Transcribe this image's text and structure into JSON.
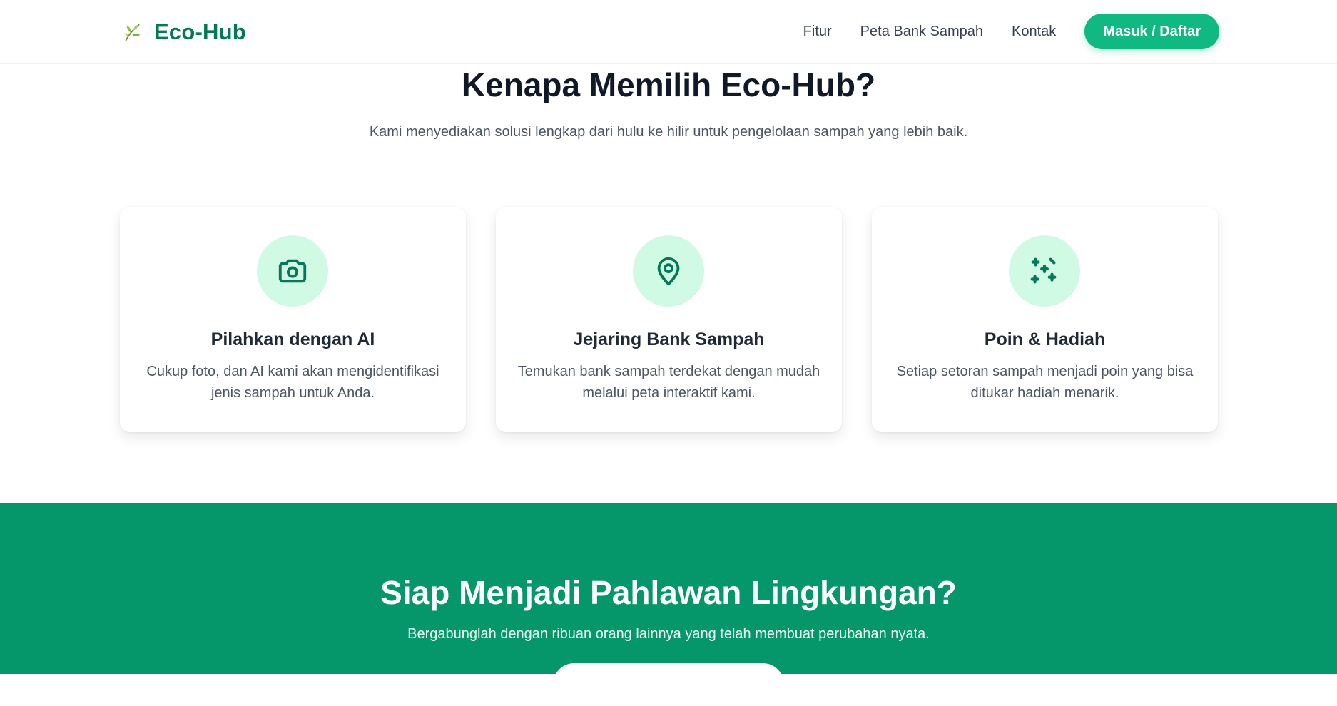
{
  "header": {
    "brand": {
      "name": "Eco-Hub",
      "icon": "leaf-icon",
      "color": "#047857"
    },
    "nav": [
      {
        "label": "Fitur"
      },
      {
        "label": "Peta Bank Sampah"
      },
      {
        "label": "Kontak"
      }
    ],
    "cta_label": "Masuk / Daftar"
  },
  "features": {
    "title": "Kenapa Memilih Eco-Hub?",
    "subtitle": "Kami menyediakan solusi lengkap dari hulu ke hilir untuk pengelolaan sampah yang lebih baik.",
    "cards": [
      {
        "icon": "camera-icon",
        "title": "Pilahkan dengan AI",
        "description": "Cukup foto, dan AI kami akan mengidentifikasi jenis sampah untuk Anda."
      },
      {
        "icon": "map-pin-icon",
        "title": "Jejaring Bank Sampah",
        "description": "Temukan bank sampah terdekat dengan mudah melalui peta interaktif kami."
      },
      {
        "icon": "sparkles-icon",
        "title": "Poin & Hadiah",
        "description": "Setiap setoran sampah menjadi poin yang bisa ditukar hadiah menarik."
      }
    ]
  },
  "cta": {
    "title": "Siap Menjadi Pahlawan Lingkungan?",
    "subtitle": "Bergabunglah dengan ribuan orang lainnya yang telah membuat perubahan nyata.",
    "button_label": ""
  },
  "colors": {
    "accent": "#10b981",
    "dark_green": "#059669",
    "icon_bg": "#d1fae5",
    "icon_fg": "#047857"
  }
}
